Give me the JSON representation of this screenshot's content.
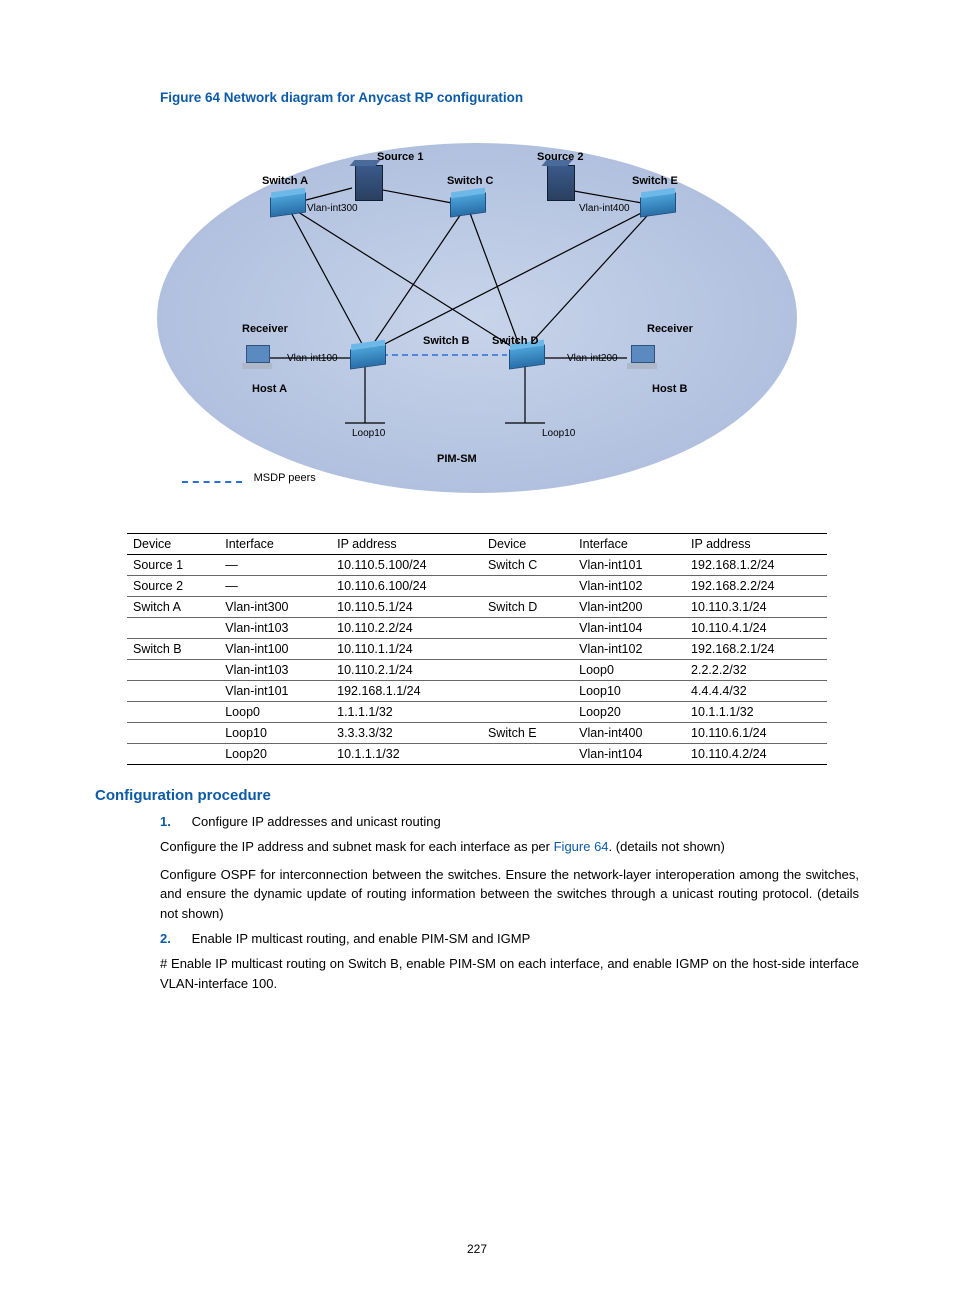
{
  "figure_caption": "Figure 64 Network diagram for Anycast RP configuration",
  "diagram": {
    "source1": "Source 1",
    "source2": "Source 2",
    "switchA": "Switch A",
    "switchB": "Switch B",
    "switchC": "Switch C",
    "switchD": "Switch D",
    "switchE": "Switch E",
    "receiver": "Receiver",
    "hostA": "Host A",
    "hostB": "Host B",
    "vlan300": "Vlan-int300",
    "vlan400": "Vlan-int400",
    "vlan100": "Vlan-int100",
    "vlan200": "Vlan-int200",
    "loop10a": "Loop10",
    "loop10b": "Loop10",
    "pim": "PIM-SM",
    "legend": "MSDP peers"
  },
  "table": {
    "headers": [
      "Device",
      "Interface",
      "IP address",
      "Device",
      "Interface",
      "IP address"
    ],
    "rows": [
      [
        "Source 1",
        "—",
        "10.110.5.100/24",
        "Switch C",
        "Vlan-int101",
        "192.168.1.2/24"
      ],
      [
        "Source 2",
        "—",
        "10.110.6.100/24",
        "",
        "Vlan-int102",
        "192.168.2.2/24"
      ],
      [
        "Switch A",
        "Vlan-int300",
        "10.110.5.1/24",
        "Switch D",
        "Vlan-int200",
        "10.110.3.1/24"
      ],
      [
        "",
        "Vlan-int103",
        "10.110.2.2/24",
        "",
        "Vlan-int104",
        "10.110.4.1/24"
      ],
      [
        "Switch B",
        "Vlan-int100",
        "10.110.1.1/24",
        "",
        "Vlan-int102",
        "192.168.2.1/24"
      ],
      [
        "",
        "Vlan-int103",
        "10.110.2.1/24",
        "",
        "Loop0",
        "2.2.2.2/32"
      ],
      [
        "",
        "Vlan-int101",
        "192.168.1.1/24",
        "",
        "Loop10",
        "4.4.4.4/32"
      ],
      [
        "",
        "Loop0",
        "1.1.1.1/32",
        "",
        "Loop20",
        "10.1.1.1/32"
      ],
      [
        "",
        "Loop10",
        "3.3.3.3/32",
        "Switch E",
        "Vlan-int400",
        "10.110.6.1/24"
      ],
      [
        "",
        "Loop20",
        "10.1.1.1/32",
        "",
        "Vlan-int104",
        "10.110.4.2/24"
      ]
    ]
  },
  "section_heading": "Configuration procedure",
  "step1_num": "1.",
  "step1": "Configure IP addresses and unicast routing",
  "para1a": "Configure the IP address and subnet mask for each interface as per ",
  "para1_link": "Figure 64",
  "para1b": ". (details not shown)",
  "para2": "Configure OSPF for interconnection between the switches. Ensure the network-layer interoperation among the switches, and ensure the dynamic update of routing information between the switches through a unicast routing protocol. (details not shown)",
  "step2_num": "2.",
  "step2": "Enable IP multicast routing, and enable PIM-SM and IGMP",
  "para3": "# Enable IP multicast routing on Switch B, enable PIM-SM on each interface, and enable IGMP on the host-side interface VLAN-interface 100.",
  "page_num": "227"
}
